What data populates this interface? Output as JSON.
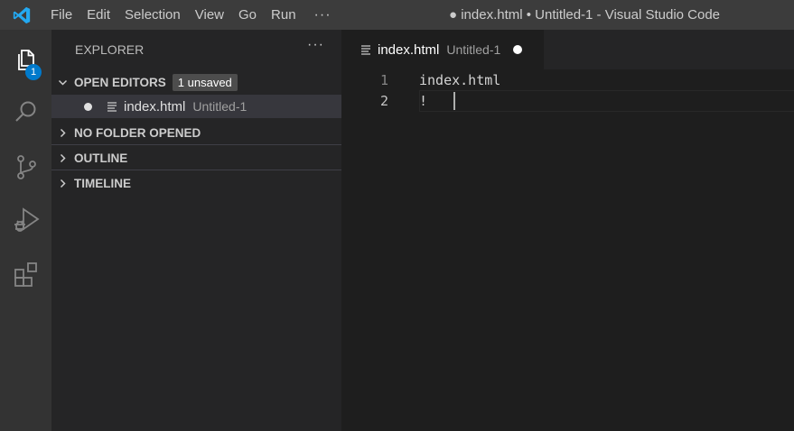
{
  "titlebar": {
    "menu": [
      "File",
      "Edit",
      "Selection",
      "View",
      "Go",
      "Run"
    ],
    "more": "···",
    "window_title": "● index.html • Untitled-1 - Visual Studio Code"
  },
  "activitybar": {
    "items": [
      "explorer-icon",
      "search-icon",
      "source-control-icon",
      "run-debug-icon",
      "extensions-icon"
    ],
    "explorer_badge": "1"
  },
  "sidebar": {
    "header": "EXPLORER",
    "more": "···",
    "sections": {
      "open_editors": "OPEN EDITORS",
      "unsaved_badge": "1 unsaved",
      "no_folder": "NO FOLDER OPENED",
      "outline": "OUTLINE",
      "timeline": "TIMELINE"
    },
    "open_file": {
      "name": "index.html",
      "description": "Untitled-1"
    }
  },
  "editor": {
    "tab": {
      "name": "index.html",
      "description": "Untitled-1"
    },
    "lines": [
      {
        "number": "1",
        "text": "index.html"
      },
      {
        "number": "2",
        "text": "!"
      }
    ]
  },
  "colors": {
    "accent": "#007acc",
    "logo": "#23a9f2"
  }
}
